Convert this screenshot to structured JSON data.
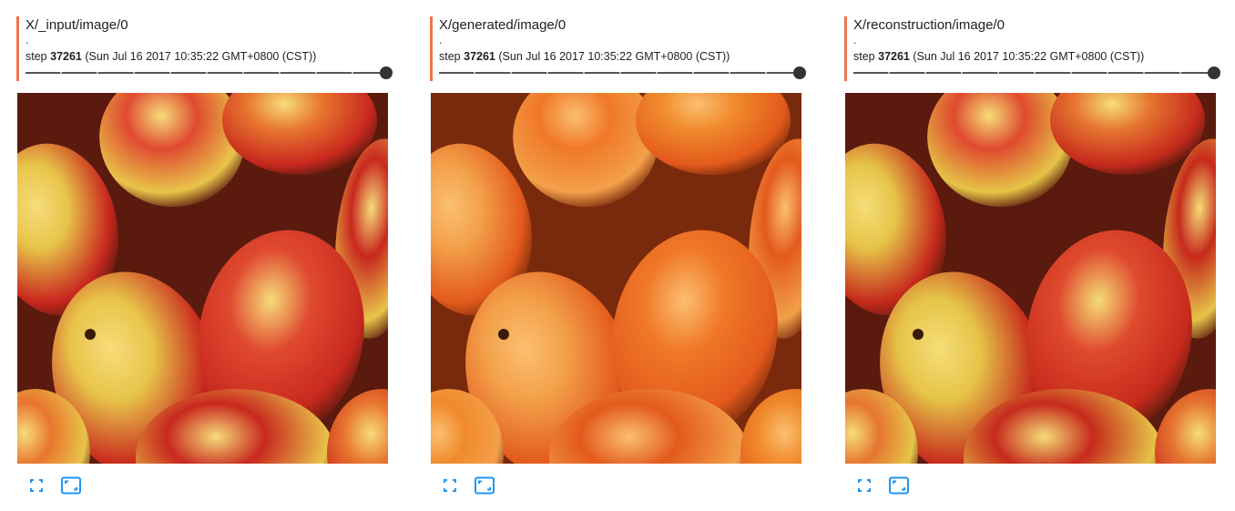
{
  "theme": {
    "accent_color": "#f0744b",
    "icon_color": "#2196f3",
    "slider_color": "#333333"
  },
  "cards": [
    {
      "title": "X/_input/image/0",
      "dot": ".",
      "step_label": "step",
      "step_number": "37261",
      "timestamp": "(Sun Jul 16 2017 10:35:22 GMT+0800 (CST))",
      "image_alt": "Red-yellow peaches, original input",
      "icons": {
        "fullscreen": "fullscreen-icon",
        "resize": "fit-to-screen-icon"
      }
    },
    {
      "title": "X/generated/image/0",
      "dot": ".",
      "step_label": "step",
      "step_number": "37261",
      "timestamp": "(Sun Jul 16 2017 10:35:22 GMT+0800 (CST))",
      "image_alt": "Orange peaches, generated",
      "icons": {
        "fullscreen": "fullscreen-icon",
        "resize": "fit-to-screen-icon"
      }
    },
    {
      "title": "X/reconstruction/image/0",
      "dot": ".",
      "step_label": "step",
      "step_number": "37261",
      "timestamp": "(Sun Jul 16 2017 10:35:22 GMT+0800 (CST))",
      "image_alt": "Red-yellow peaches, reconstruction",
      "icons": {
        "fullscreen": "fullscreen-icon",
        "resize": "fit-to-screen-icon"
      }
    }
  ],
  "palettes": {
    "input": {
      "bg": "#5a1a0e",
      "red": "#c8281e",
      "redlight": "#e04a30",
      "yellow": "#e8c44a",
      "orange": "#e8752e",
      "highlight": "#f6dc7a"
    },
    "generated": {
      "bg": "#7a2a0c",
      "red": "#e35a1c",
      "redlight": "#f07828",
      "yellow": "#f3a04a",
      "orange": "#f08a2c",
      "highlight": "#fbbf70"
    },
    "reconstruction": {
      "bg": "#5a1a0e",
      "red": "#c62a1c",
      "redlight": "#df4a2e",
      "yellow": "#e6c448",
      "orange": "#e67530",
      "highlight": "#f5dd78"
    }
  }
}
